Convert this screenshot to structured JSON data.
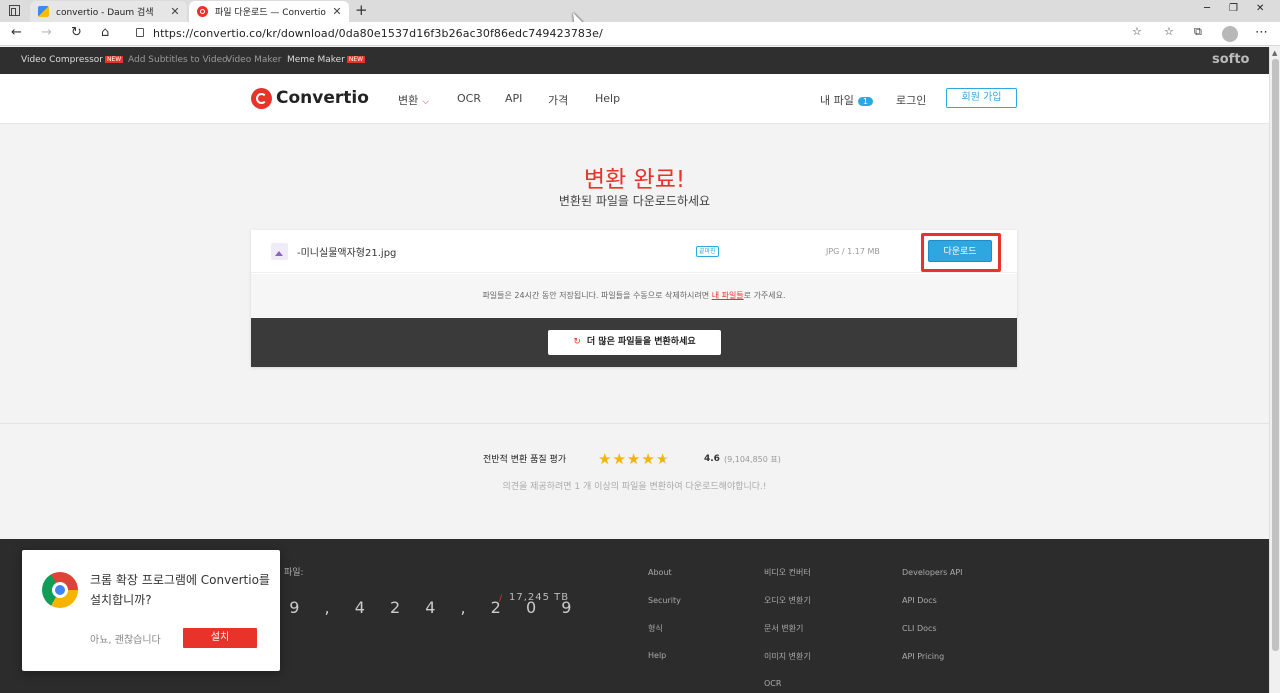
{
  "browser": {
    "tabs": [
      {
        "title": "convertio - Daum 검색",
        "active": false
      },
      {
        "title": "파일 다운로드 — Convertio",
        "active": true
      }
    ],
    "new_tab": "+",
    "url": "https://convertio.co/kr/download/0da80e1537d16f3b26ac30f86edc749423783e/"
  },
  "promo_bar": {
    "items": [
      {
        "label": "Video Compressor",
        "badge": "NEW"
      },
      {
        "label": "Add Subtitles to Video",
        "badge": ""
      },
      {
        "label": "Video Maker",
        "badge": ""
      },
      {
        "label": "Meme Maker",
        "badge": "NEW"
      }
    ],
    "brand": "softo"
  },
  "header": {
    "logo": "Convertio",
    "nav": [
      "변환",
      "OCR",
      "API",
      "가격",
      "Help"
    ],
    "my_files": "내 파일",
    "my_files_count": "1",
    "login": "로그인",
    "signup": "회원 가입"
  },
  "main": {
    "title": "변환 완료!",
    "subtitle": "변환된 파일을 다운로드하세요",
    "file": {
      "name": "-미니실물액자형21.jpg",
      "status": "끝마친",
      "meta": "JPG / 1.17 MB",
      "download_label": "다운로드"
    },
    "note_prefix": "파일들은 24시간 동안 저장됩니다. 파일들을 수동으로 삭제하시려면 ",
    "note_link": "내 파일들",
    "note_suffix": "로 가주세요.",
    "more_button": "더 많은 파일들을 변환하세요"
  },
  "rating": {
    "label": "전반적 변환 품질 평가",
    "stars": 4.6,
    "value": "4.6",
    "count": "(9,104,850 표)",
    "hint": "의견을 제공하려면 1 개 이상의 파일을 변환하여 다운로드해야합니다.!"
  },
  "footer": {
    "label": "파일:",
    "count": "9 9 , 4 2 4 , 2 0 9",
    "slash": "/",
    "tb": "17,245 TB",
    "col1": [
      "About",
      "Security",
      "형식",
      "Help"
    ],
    "col2": [
      "비디오 컨버터",
      "오디오 변환기",
      "문서 변환기",
      "이미지 변환기",
      "OCR"
    ],
    "col3": [
      "Developers API",
      "API Docs",
      "CLI Docs",
      "API Pricing"
    ]
  },
  "popup": {
    "message": "크롬 확장 프로그램에 Convertio를 설치합니까?",
    "decline": "아뇨, 괜찮습니다",
    "install": "설치"
  },
  "colors": {
    "accent": "#e8332a",
    "primary_blue": "#2ea7e0",
    "footer_bg": "#2c2c2c",
    "star": "#f5b400"
  }
}
